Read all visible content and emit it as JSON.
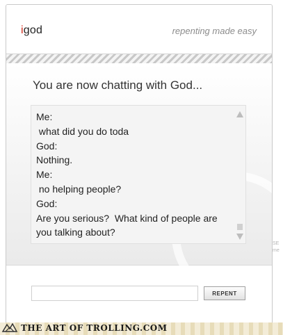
{
  "header": {
    "logo_prefix": "i",
    "logo_rest": "god",
    "tagline": "repenting made easy"
  },
  "main": {
    "heading": "You are now chatting with God...",
    "chat_lines": [
      "Me:",
      " what did you do toda",
      "God:",
      "Nothing.",
      "Me:",
      " no helping people?",
      "God:",
      "Are you serious?  What kind of people are",
      "you talking about?"
    ]
  },
  "footer": {
    "input_value": "",
    "repent_label": "REPENT"
  },
  "side_text": [
    "SE",
    "me"
  ],
  "watermark": {
    "text": "THE ART OF TROLLING.COM"
  },
  "colors": {
    "logo_accent": "#d12a1a",
    "tagline": "#8c8c8c"
  }
}
